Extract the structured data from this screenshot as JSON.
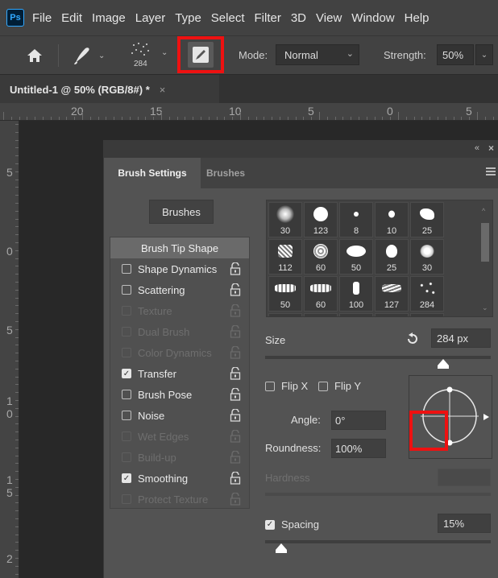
{
  "menubar": {
    "logo": "Ps",
    "items": [
      "File",
      "Edit",
      "Image",
      "Layer",
      "Type",
      "Select",
      "Filter",
      "3D",
      "View",
      "Window",
      "Help"
    ]
  },
  "options": {
    "brush_size": "284",
    "mode_label": "Mode:",
    "mode_value": "Normal",
    "strength_label": "Strength:",
    "strength_value": "50%",
    "highlight_color": "#ee1111"
  },
  "document": {
    "tab_label": "Untitled-1 @ 50% (RGB/8#) *",
    "close": "×"
  },
  "rulers": {
    "h_labels": [
      "20",
      "15",
      "10",
      "5",
      "0",
      "5"
    ],
    "v_labels": [
      "5",
      "0",
      "5",
      "1",
      "0",
      "1",
      "5",
      "2"
    ]
  },
  "panel": {
    "tabs": [
      "Brush Settings",
      "Brushes"
    ],
    "brushes_button": "Brushes",
    "tip_shape": "Brush Tip Shape",
    "settings": [
      {
        "label": "Shape Dynamics",
        "checked": false,
        "enabled": true
      },
      {
        "label": "Scattering",
        "checked": false,
        "enabled": true
      },
      {
        "label": "Texture",
        "checked": false,
        "enabled": false
      },
      {
        "label": "Dual Brush",
        "checked": false,
        "enabled": false
      },
      {
        "label": "Color Dynamics",
        "checked": false,
        "enabled": false
      },
      {
        "label": "Transfer",
        "checked": true,
        "enabled": true
      },
      {
        "label": "Brush Pose",
        "checked": false,
        "enabled": true
      },
      {
        "label": "Noise",
        "checked": false,
        "enabled": true
      },
      {
        "label": "Wet Edges",
        "checked": false,
        "enabled": false
      },
      {
        "label": "Build-up",
        "checked": false,
        "enabled": false
      },
      {
        "label": "Smoothing",
        "checked": true,
        "enabled": true
      },
      {
        "label": "Protect Texture",
        "checked": false,
        "enabled": false
      }
    ],
    "tips": [
      [
        "30",
        "123",
        "8",
        "10",
        "25"
      ],
      [
        "112",
        "60",
        "50",
        "25",
        "30"
      ],
      [
        "50",
        "60",
        "100",
        "127",
        "284"
      ]
    ],
    "size_label": "Size",
    "size_value": "284 px",
    "flip_x": "Flip X",
    "flip_y": "Flip Y",
    "angle_label": "Angle:",
    "angle_value": "0°",
    "roundness_label": "Roundness:",
    "roundness_value": "100%",
    "hardness_label": "Hardness",
    "spacing_label": "Spacing",
    "spacing_value": "15%",
    "spacing_checked": true
  }
}
